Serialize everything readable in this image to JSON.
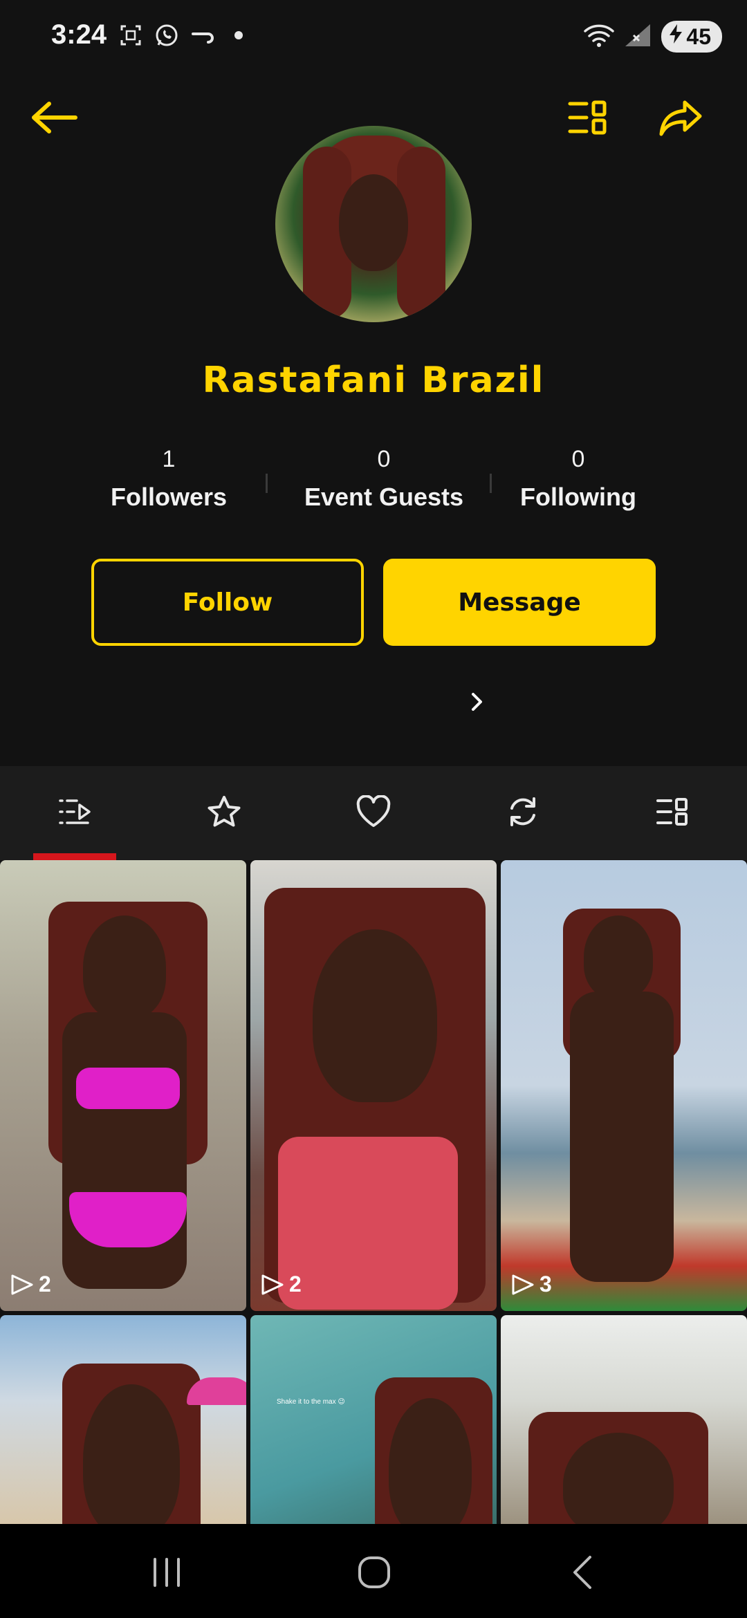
{
  "status_bar": {
    "time": "3:24",
    "left_icons": [
      "screenshot-icon",
      "whatsapp-icon",
      "missed-call-icon",
      "dot-icon"
    ],
    "right_icons": [
      "wifi-icon",
      "signal-icon"
    ],
    "battery": "45"
  },
  "header": {
    "back_icon": "arrow-left-icon",
    "menu_icon": "list-grid-icon",
    "share_icon": "share-arrow-icon"
  },
  "profile": {
    "name": "Rastafani Brazil",
    "stats": [
      {
        "value": "1",
        "label": "Followers"
      },
      {
        "value": "0",
        "label": "Event Guests"
      },
      {
        "value": "0",
        "label": "Following"
      }
    ],
    "follow_label": "Follow",
    "message_label": "Message"
  },
  "tabs": [
    {
      "name": "videos",
      "icon": "list-play-icon",
      "active": true
    },
    {
      "name": "favorites",
      "icon": "star-icon",
      "active": false
    },
    {
      "name": "likes",
      "icon": "heart-icon",
      "active": false
    },
    {
      "name": "reposts",
      "icon": "refresh-icon",
      "active": false
    },
    {
      "name": "collections",
      "icon": "list-grid-icon",
      "active": false
    }
  ],
  "grid": {
    "items": [
      {
        "plays": "2"
      },
      {
        "plays": "2"
      },
      {
        "plays": "3"
      },
      {
        "caption": "Shake it to the max 😉"
      }
    ]
  },
  "colors": {
    "accent": "#ffd400",
    "background": "#121212",
    "tab_indicator": "#d6161c"
  }
}
